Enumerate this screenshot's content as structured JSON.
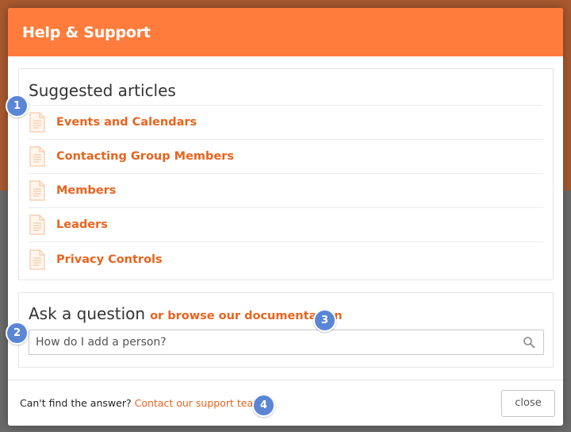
{
  "modal": {
    "title": "Help & Support",
    "accent_color": "#ff7c3c",
    "link_color": "#e8641e"
  },
  "articles": {
    "heading": "Suggested articles",
    "icon": "document-icon",
    "items": [
      {
        "label": "Events and Calendars"
      },
      {
        "label": "Contacting Group Members"
      },
      {
        "label": "Members"
      },
      {
        "label": "Leaders"
      },
      {
        "label": "Privacy Controls"
      }
    ]
  },
  "ask": {
    "heading": "Ask a question",
    "browse_link": "or browse our documentation",
    "search_placeholder": "How do I add a person?",
    "search_icon": "search-icon"
  },
  "footer": {
    "text": "Can't find the answer?",
    "support_link": "Contact our support team.",
    "close_label": "close"
  },
  "markers": [
    "1",
    "2",
    "3",
    "4"
  ]
}
